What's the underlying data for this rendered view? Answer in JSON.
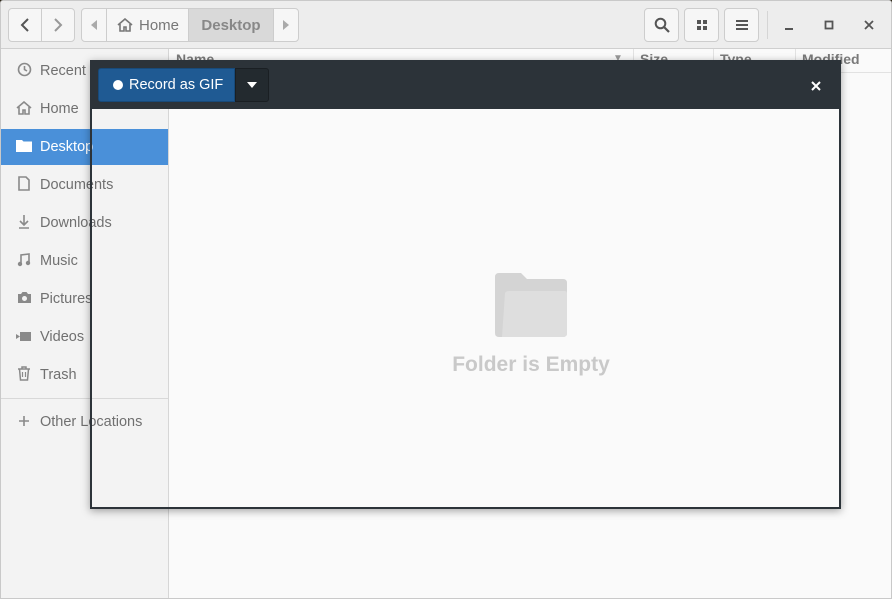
{
  "header": {
    "back_icon": "chevron-left-icon",
    "forward_icon": "chevron-right-icon",
    "breadcrumb": [
      {
        "label": "Home",
        "icon": "home-icon"
      },
      {
        "label": "Desktop"
      }
    ],
    "search_icon": "search-icon",
    "view_icon": "grid-view-icon",
    "menu_icon": "hamburger-menu-icon",
    "window_controls": [
      "minimize",
      "maximize",
      "close"
    ]
  },
  "sidebar": {
    "items": [
      {
        "label": "Recent",
        "icon": "clock-icon"
      },
      {
        "label": "Home",
        "icon": "home-icon"
      },
      {
        "label": "Desktop",
        "icon": "folder-icon",
        "active": true
      },
      {
        "label": "Documents",
        "icon": "document-icon"
      },
      {
        "label": "Downloads",
        "icon": "download-icon"
      },
      {
        "label": "Music",
        "icon": "music-icon"
      },
      {
        "label": "Pictures",
        "icon": "camera-icon"
      },
      {
        "label": "Videos",
        "icon": "video-icon"
      },
      {
        "label": "Trash",
        "icon": "trash-icon"
      }
    ],
    "other_locations": {
      "label": "Other Locations",
      "icon": "plus-icon"
    }
  },
  "columns": [
    "Name",
    "Size",
    "Type",
    "Modified"
  ],
  "empty_state": {
    "text": "Folder is Empty",
    "icon": "folder-icon"
  },
  "peek": {
    "record_label": "Record as GIF",
    "record_icon": "record-dot-icon",
    "dropdown_icon": "caret-down-icon",
    "close_icon": "close-icon",
    "accent_color": "#1f5a93",
    "bar_color": "#2c3339"
  },
  "colors": {
    "selection": "#4a90d9"
  }
}
